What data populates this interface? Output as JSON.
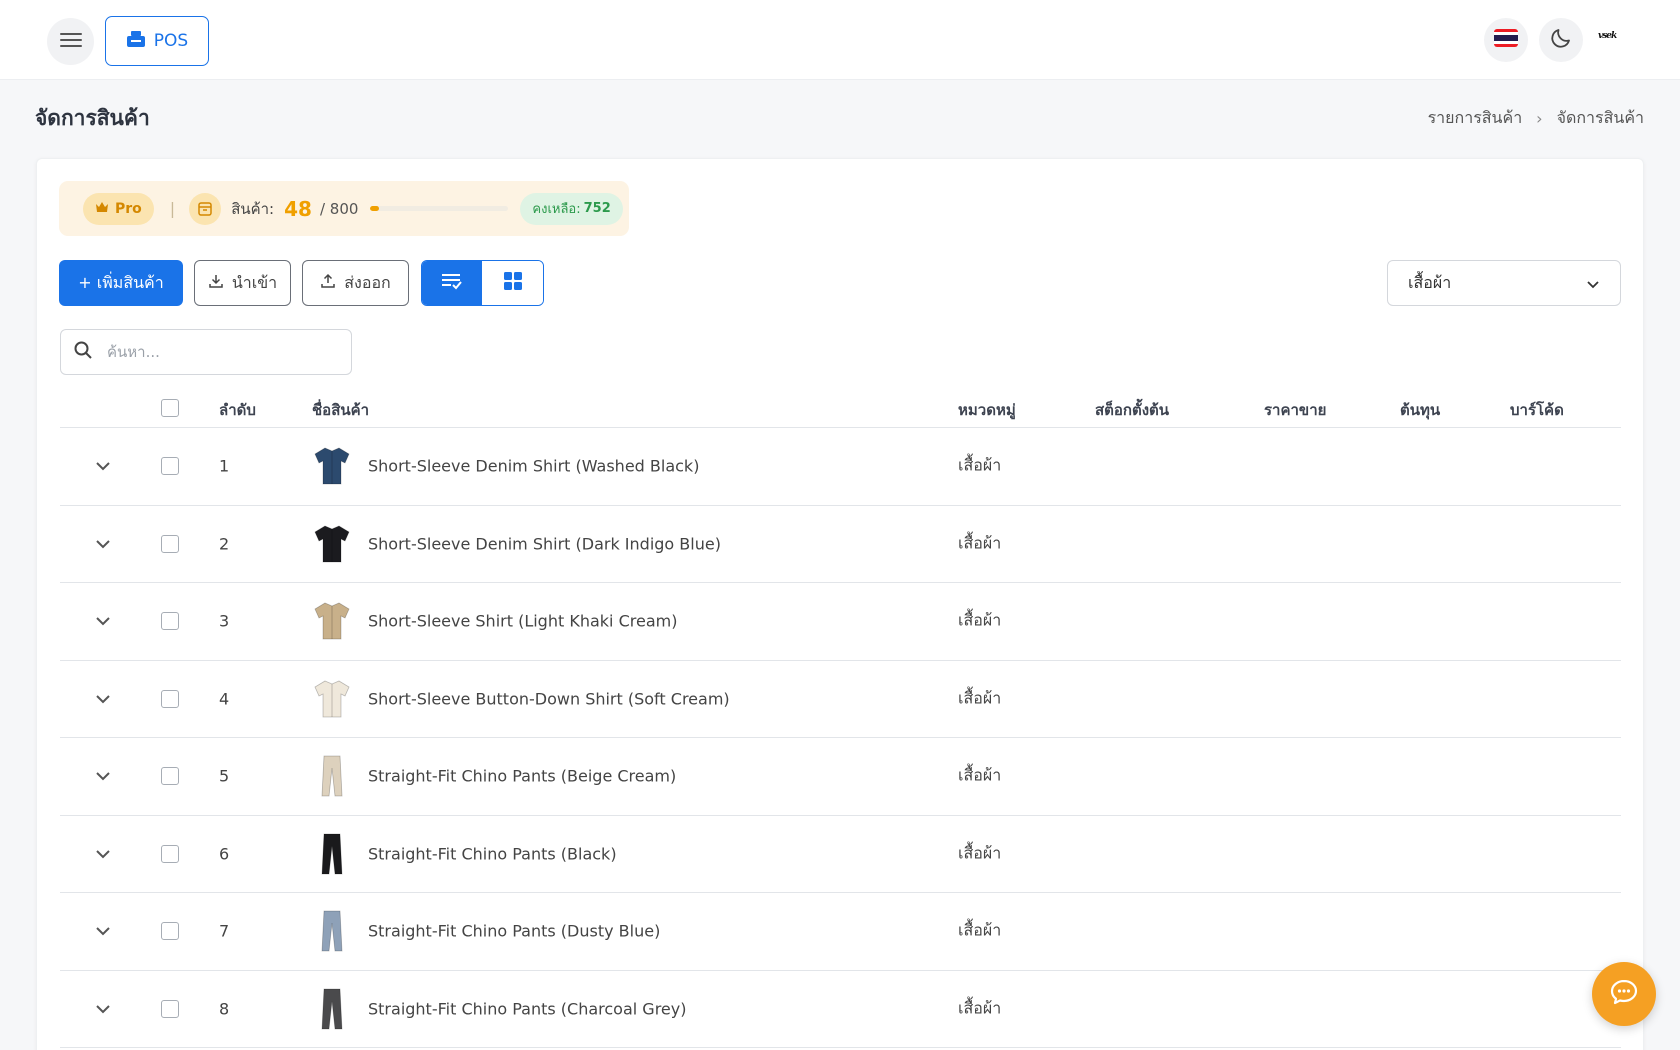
{
  "header": {
    "pos_label": "POS",
    "brand_text": "vsek"
  },
  "page": {
    "title": "จัดการสินค้า",
    "breadcrumb": [
      "รายการสินค้า",
      "จัดการสินค้า"
    ]
  },
  "plan": {
    "badge": "Pro",
    "product_label": "สินค้า:",
    "count": "48",
    "total": "/ 800",
    "usage_fraction": 0.06,
    "remaining_label": "คงเหลือ:",
    "remaining_value": "752"
  },
  "toolbar": {
    "add_label": "+ เพิ่มสินค้า",
    "import_label": "นำเข้า",
    "export_label": "ส่งออก",
    "category_selected": "เสื้อผ้า"
  },
  "search": {
    "placeholder": "ค้นหา..."
  },
  "table": {
    "headers": {
      "index": "ลำดับ",
      "name": "ชื่อสินค้า",
      "category": "หมวดหมู่",
      "stock": "สต็อกตั้งต้น",
      "price": "ราคาขาย",
      "cost": "ต้นทุน",
      "barcode": "บาร์โค้ด"
    },
    "rows": [
      {
        "index": "1",
        "name": "Short-Sleeve Denim Shirt (Washed Black)",
        "category": "เสื้อผ้า",
        "icon": "shirt-icon",
        "color": "#2c4a6e"
      },
      {
        "index": "2",
        "name": "Short-Sleeve Denim Shirt (Dark Indigo Blue)",
        "category": "เสื้อผ้า",
        "icon": "shirt-icon",
        "color": "#1b1b1f"
      },
      {
        "index": "3",
        "name": "Short-Sleeve Shirt (Light Khaki Cream)",
        "category": "เสื้อผ้า",
        "icon": "shirt-icon",
        "color": "#c8b08a"
      },
      {
        "index": "4",
        "name": "Short-Sleeve Button-Down Shirt (Soft Cream)",
        "category": "เสื้อผ้า",
        "icon": "shirt-icon",
        "color": "#efe8db"
      },
      {
        "index": "5",
        "name": "Straight-Fit Chino Pants (Beige Cream)",
        "category": "เสื้อผ้า",
        "icon": "pants-icon",
        "color": "#ddd1bd"
      },
      {
        "index": "6",
        "name": "Straight-Fit Chino Pants (Black)",
        "category": "เสื้อผ้า",
        "icon": "pants-icon",
        "color": "#1a1a1c"
      },
      {
        "index": "7",
        "name": "Straight-Fit Chino Pants (Dusty Blue)",
        "category": "เสื้อผ้า",
        "icon": "pants-icon",
        "color": "#8ea1b8"
      },
      {
        "index": "8",
        "name": "Straight-Fit Chino Pants (Charcoal Grey)",
        "category": "เสื้อผ้า",
        "icon": "pants-icon",
        "color": "#4a4a4c"
      }
    ]
  },
  "colors": {
    "accent": "#1a73e8",
    "pro": "#f0a000",
    "remaining": "#2c9a4c",
    "chat": "#f5a023"
  }
}
